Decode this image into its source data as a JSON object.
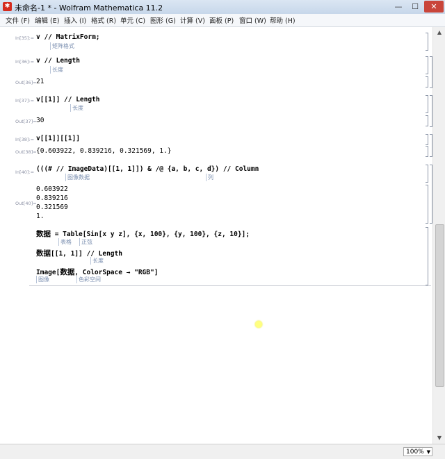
{
  "window": {
    "title": "未命名-1 * - Wolfram Mathematica 11.2",
    "minimize": "—",
    "maximize": "☐",
    "close": "✕"
  },
  "menu": [
    "文件 (F)",
    "编辑 (E)",
    "插入 (I)",
    "格式 (R)",
    "单元 (C)",
    "图形 (G)",
    "计算 (V)",
    "面板 (P)",
    "窗口 (W)",
    "帮助 (H)"
  ],
  "cells": {
    "c1": {
      "in_label": "In[35]:=",
      "code": "v // MatrixForm;",
      "hint": "矩阵格式"
    },
    "c2": {
      "in_label": "In[36]:=",
      "code": "v // Length",
      "hint": "长度",
      "out_label": "Out[36]=",
      "out": "21"
    },
    "c3": {
      "in_label": "In[37]:=",
      "code": "v[[1]] // Length",
      "hint": "长度",
      "out_label": "Out[37]=",
      "out": "30"
    },
    "c4": {
      "in_label": "In[38]:=",
      "code": "v[[1]][[1]]",
      "out_label": "Out[38]=",
      "out": "{0.603922, 0.839216, 0.321569, 1.}"
    },
    "c5": {
      "in_label": "In[40]:=",
      "code": "(((# // ImageData)[[1, 1]]) & /@ {a, b, c, d}) // Column",
      "hint1": "图像数据",
      "hint2": "列",
      "out_label": "Out[40]=",
      "out_lines": [
        "0.603922",
        "0.839216",
        "0.321569",
        "1."
      ]
    },
    "c6": {
      "line1_var": "数据",
      "line1_rest": " = Table[Sin[x y z], {x, 100}, {y, 100}, {z, 10}];",
      "hint1": "表格",
      "hint2": "正弦",
      "line2_var": "数据",
      "line2_rest": "[[1, 1]] // Length",
      "hint3": "长度",
      "line3_pre": "Image[",
      "line3_var": "数据",
      "line3_rest": ", ColorSpace → \"RGB\"]",
      "hint4": "图像",
      "hint5": "色彩空间"
    }
  },
  "status": {
    "zoom": "100%"
  }
}
